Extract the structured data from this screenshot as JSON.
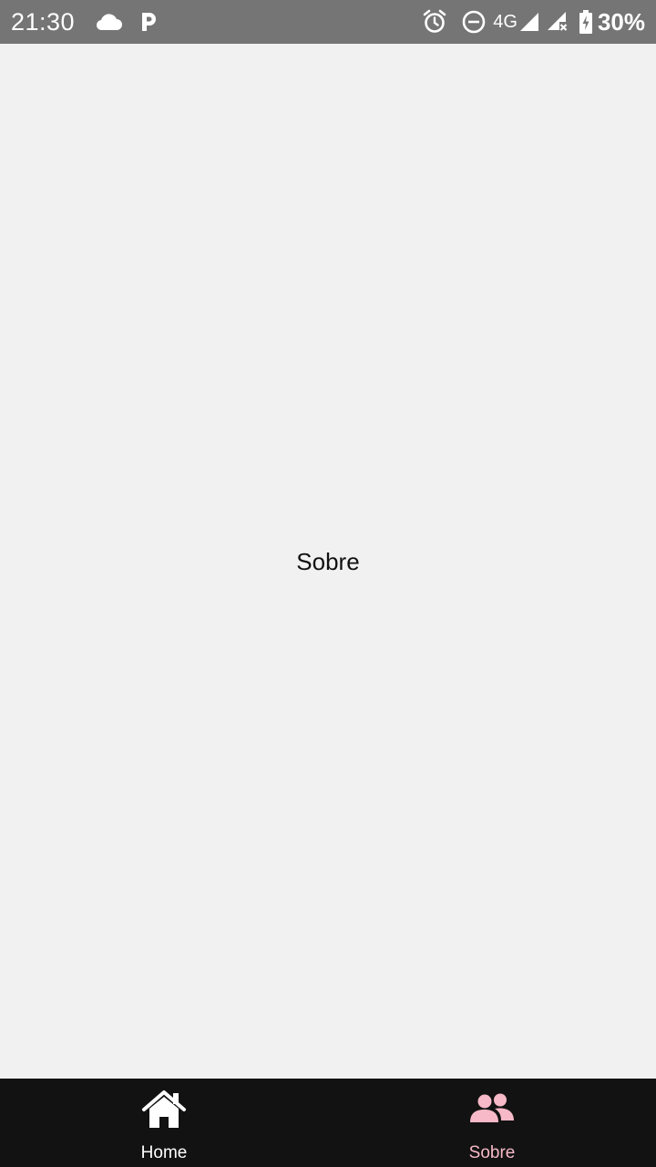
{
  "status_bar": {
    "time": "21:30",
    "network": "4G",
    "battery": "30%",
    "icons": [
      "cloud-icon",
      "parking-icon",
      "alarm-icon",
      "dnd-icon",
      "signal-icon",
      "signal-no-data-icon",
      "battery-charging-icon"
    ]
  },
  "screen": {
    "text": "Sobre"
  },
  "tab_bar": {
    "tabs": [
      {
        "label": "Home",
        "icon": "home-icon",
        "active": false,
        "color": "#ffffff"
      },
      {
        "label": "Sobre",
        "icon": "users-icon",
        "active": true,
        "color": "#f7b9c7"
      }
    ],
    "background": "#121212"
  },
  "colors": {
    "status_bar_bg": "#757575",
    "content_bg": "#f1f1f1",
    "active_tint": "#f7b9c7"
  }
}
